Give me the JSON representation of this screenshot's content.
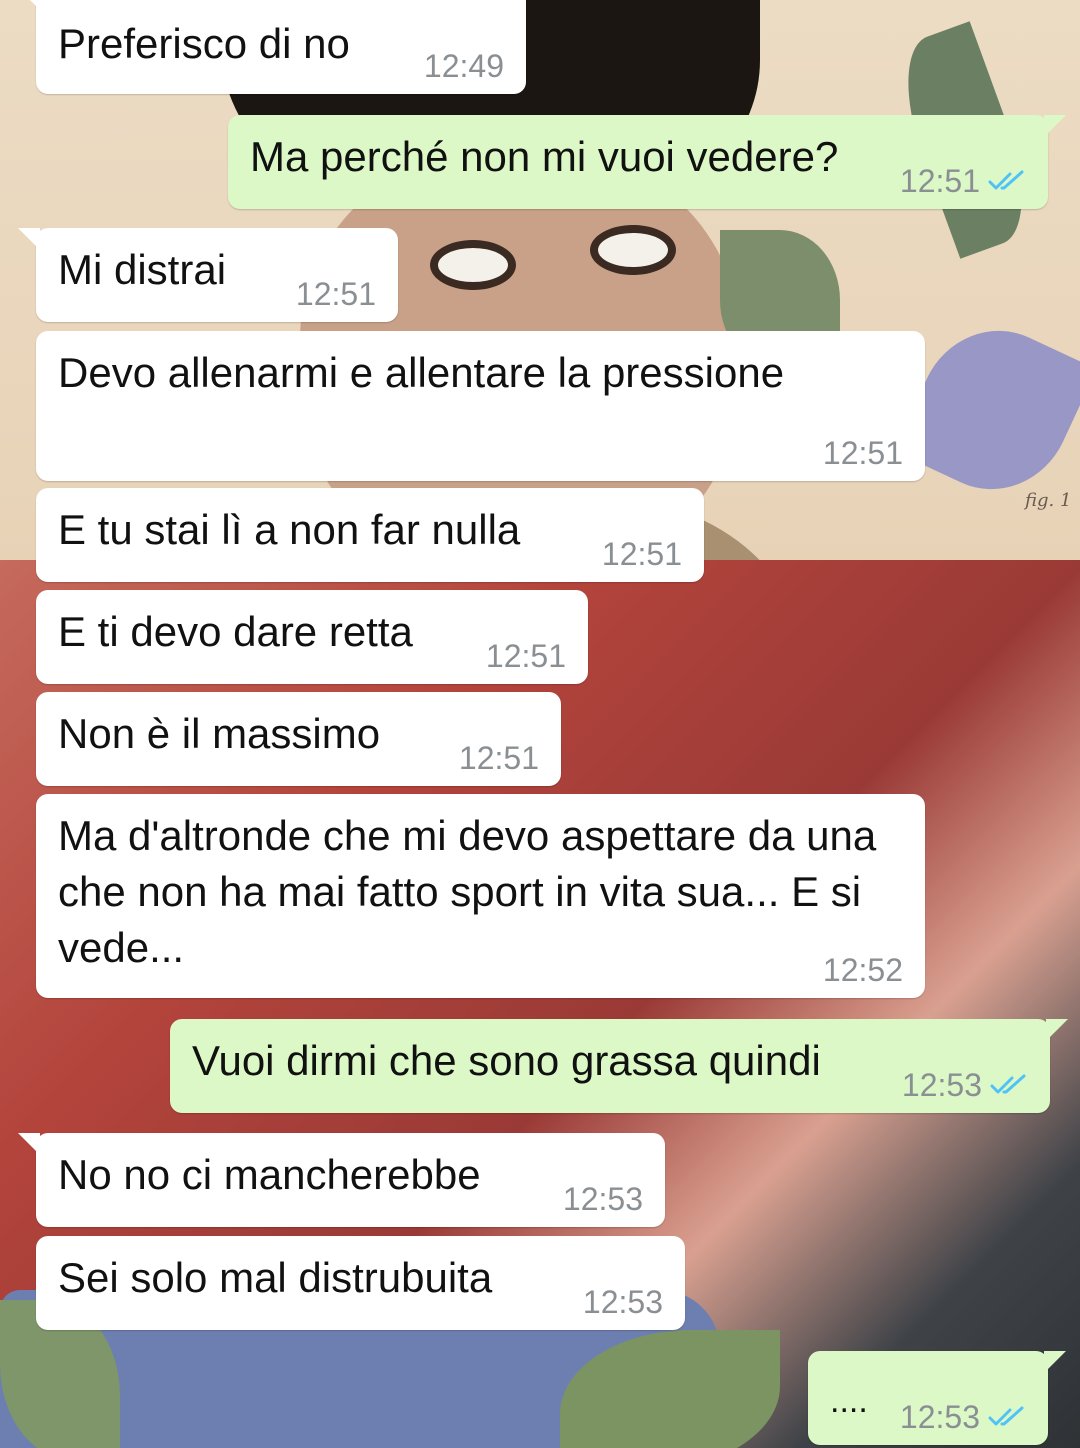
{
  "colors": {
    "incoming_bubble": "#ffffff",
    "outgoing_bubble": "#dcf8c6",
    "timestamp": "#8a8f93",
    "read_ticks": "#4fc3f7"
  },
  "messages": [
    {
      "direction": "in",
      "text": "Preferisco di no",
      "time": "12:49"
    },
    {
      "direction": "out",
      "text": "Ma perché non mi vuoi vedere?",
      "time": "12:51",
      "status": "read"
    },
    {
      "direction": "in",
      "text": "Mi distrai",
      "time": "12:51"
    },
    {
      "direction": "in",
      "text": "Devo allenarmi e allentare la pressione",
      "time": "12:51"
    },
    {
      "direction": "in",
      "text": "E tu stai lì a non far nulla",
      "time": "12:51"
    },
    {
      "direction": "in",
      "text": "E ti devo dare retta",
      "time": "12:51"
    },
    {
      "direction": "in",
      "text": "Non è il massimo",
      "time": "12:51"
    },
    {
      "direction": "in",
      "text": "Ma d'altronde che mi devo aspettare da una che non ha mai fatto sport in vita sua... E si vede...",
      "time": "12:52"
    },
    {
      "direction": "out",
      "text": "Vuoi dirmi che sono grassa quindi",
      "time": "12:53",
      "status": "read"
    },
    {
      "direction": "in",
      "text": "No no ci mancherebbe",
      "time": "12:53"
    },
    {
      "direction": "in",
      "text": "Sei solo mal distrubuita",
      "time": "12:53"
    },
    {
      "direction": "out",
      "text": "....",
      "time": "12:53",
      "status": "read"
    }
  ],
  "wallpaper": {
    "caption": "fig. 1"
  }
}
